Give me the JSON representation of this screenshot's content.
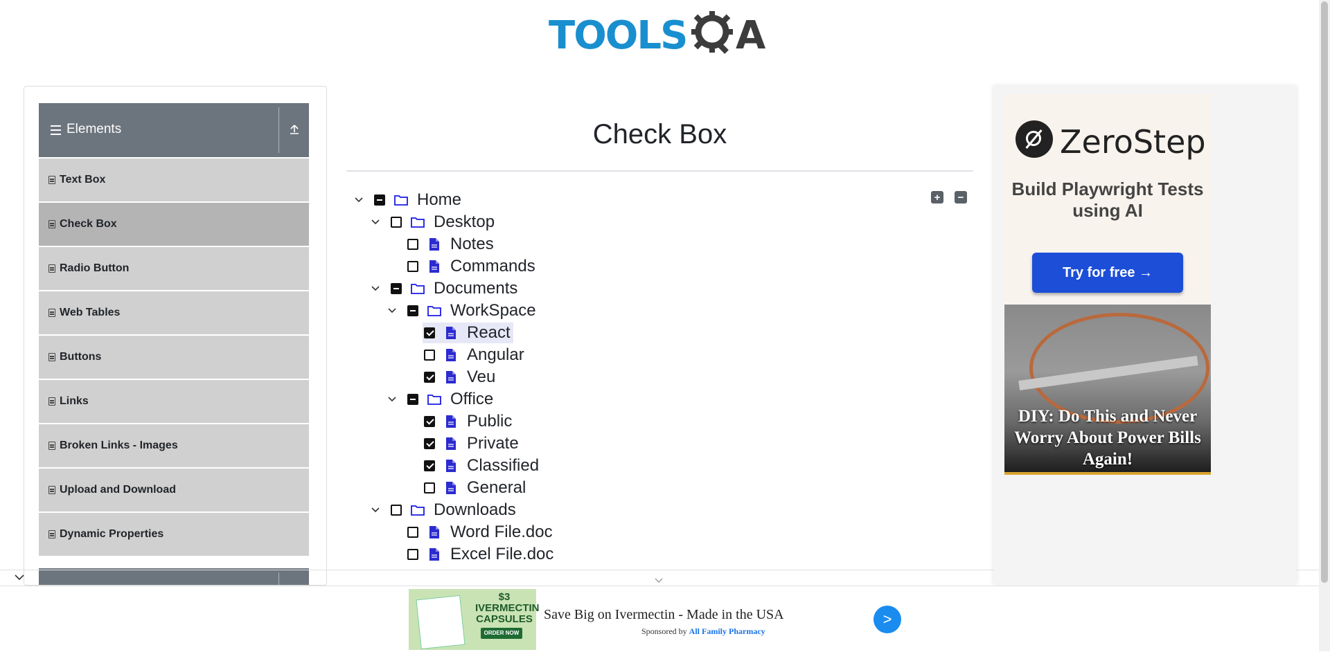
{
  "brand": {
    "logo_text": "TOOLS",
    "logo_suffix": "A"
  },
  "sidebar": {
    "group_title": "Elements",
    "items": [
      {
        "label": "Text Box",
        "active": false
      },
      {
        "label": "Check Box",
        "active": true
      },
      {
        "label": "Radio Button",
        "active": false
      },
      {
        "label": "Web Tables",
        "active": false
      },
      {
        "label": "Buttons",
        "active": false
      },
      {
        "label": "Links",
        "active": false
      },
      {
        "label": "Broken Links - Images",
        "active": false
      },
      {
        "label": "Upload and Download",
        "active": false
      },
      {
        "label": "Dynamic Properties",
        "active": false
      }
    ]
  },
  "main": {
    "title": "Check Box",
    "tree": [
      {
        "label": "Home",
        "type": "folder",
        "expanded": true,
        "state": "half",
        "depth": 0
      },
      {
        "label": "Desktop",
        "type": "folder",
        "expanded": true,
        "state": "unchecked",
        "depth": 1
      },
      {
        "label": "Notes",
        "type": "file",
        "state": "unchecked",
        "depth": 2
      },
      {
        "label": "Commands",
        "type": "file",
        "state": "unchecked",
        "depth": 2
      },
      {
        "label": "Documents",
        "type": "folder",
        "expanded": true,
        "state": "half",
        "depth": 1
      },
      {
        "label": "WorkSpace",
        "type": "folder",
        "expanded": true,
        "state": "half",
        "depth": 2
      },
      {
        "label": "React",
        "type": "file",
        "state": "checked",
        "depth": 3,
        "highlighted": true
      },
      {
        "label": "Angular",
        "type": "file",
        "state": "unchecked",
        "depth": 3
      },
      {
        "label": "Veu",
        "type": "file",
        "state": "checked",
        "depth": 3
      },
      {
        "label": "Office",
        "type": "folder",
        "expanded": true,
        "state": "half",
        "depth": 2
      },
      {
        "label": "Public",
        "type": "file",
        "state": "checked",
        "depth": 3
      },
      {
        "label": "Private",
        "type": "file",
        "state": "checked",
        "depth": 3
      },
      {
        "label": "Classified",
        "type": "file",
        "state": "checked",
        "depth": 3
      },
      {
        "label": "General",
        "type": "file",
        "state": "unchecked",
        "depth": 3
      },
      {
        "label": "Downloads",
        "type": "folder",
        "expanded": true,
        "state": "unchecked",
        "depth": 1
      },
      {
        "label": "Word File.doc",
        "type": "file",
        "state": "unchecked",
        "depth": 2
      },
      {
        "label": "Excel File.doc",
        "type": "file",
        "state": "unchecked",
        "depth": 2
      }
    ],
    "expand_all_icon": "plus-square-icon",
    "collapse_all_icon": "minus-square-icon"
  },
  "right_ad": {
    "brand": "ZeroStep",
    "tagline": "Build Playwright Tests using AI",
    "cta": "Try for free →",
    "promo_text": "DIY: Do This and Never Worry About Power Bills Again!"
  },
  "bottom_ad": {
    "image_price": "$3",
    "image_product": "IVERMECTIN CAPSULES",
    "image_button": "ORDER NOW",
    "title": "Save Big on Ivermectin - Made in the USA",
    "sponsored_prefix": "Sponsored by",
    "sponsor": "All Family Pharmacy",
    "cta": ">"
  },
  "colors": {
    "folder_icon": "#1a1ae6",
    "file_icon": "#2b2bd0",
    "group_header": "#6c757d",
    "brand_blue": "#1a8fd0"
  }
}
